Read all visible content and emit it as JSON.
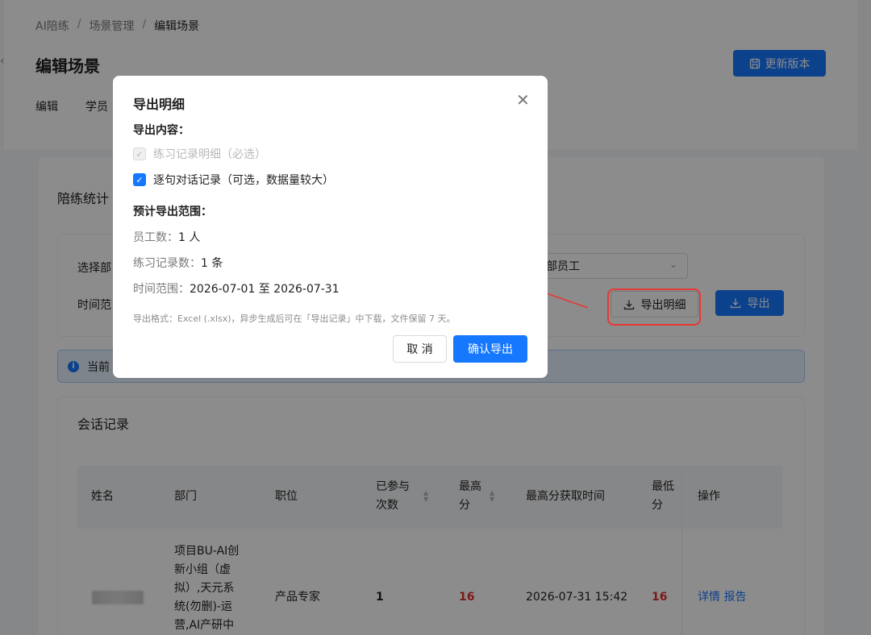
{
  "breadcrumb": {
    "items": [
      "AI陪练",
      "场景管理",
      "编辑场景"
    ],
    "separator": "/"
  },
  "page": {
    "title": "编辑场景",
    "update_button": "更新版本"
  },
  "tabs": [
    "编辑",
    "学员"
  ],
  "stats": {
    "title": "陪练统计",
    "filter": {
      "dept_label": "选择部",
      "time_label": "时间范",
      "select_value": "部员工",
      "export_detail_button": "导出明细",
      "export_button": "导出"
    },
    "info_text": "当前"
  },
  "session": {
    "title": "会话记录",
    "columns": [
      {
        "label_lines": [
          "姓名"
        ]
      },
      {
        "label_lines": [
          "部门"
        ]
      },
      {
        "label_lines": [
          "职位"
        ]
      },
      {
        "label_lines": [
          "已参与",
          "次数"
        ],
        "sortable": true
      },
      {
        "label_lines": [
          "最高",
          "分"
        ],
        "sortable": true
      },
      {
        "label_lines": [
          "最高分获取时间"
        ]
      },
      {
        "label_lines": [
          "最低",
          "分"
        ]
      },
      {
        "label_lines": [
          "操作"
        ]
      }
    ],
    "rows": [
      {
        "dept_lines": [
          "项目BU-AI创",
          "新小组（虚",
          "拟）,天元系",
          "统(勿删)-运",
          "营,AI产研中"
        ],
        "position": "产品专家",
        "count": "1",
        "max_score": "16",
        "max_time": "2026-07-31 15:42",
        "min_score": "16",
        "actions": [
          "详情",
          "报告"
        ]
      }
    ]
  },
  "modal": {
    "title": "导出明细",
    "content_heading": "导出内容：",
    "options": [
      {
        "label": "练习记录明细（必选）",
        "checked": true,
        "disabled": true
      },
      {
        "label": "逐句对话记录（可选，数据量较大）",
        "checked": true,
        "disabled": false
      }
    ],
    "range_heading": "预计导出范围：",
    "employees_label": "员工数：",
    "employees_value": "1 人",
    "records_label": "练习记录数：",
    "records_value": "1 条",
    "time_label": "时间范围：",
    "time_value": "2026-07-01 至 2026-07-31",
    "hint": "导出格式：Excel (.xlsx)，异步生成后可在「导出记录」中下载，文件保留 7 天。",
    "cancel_button": "取 消",
    "confirm_button": "确认导出"
  },
  "colors": {
    "primary": "#1677ff",
    "danger": "#e53935",
    "score_red": "#e0302d"
  },
  "icons": [
    "chevron-left-icon",
    "save-icon",
    "download-icon",
    "chevron-down-icon",
    "info-icon",
    "sort-icon",
    "close-icon",
    "check-icon"
  ]
}
